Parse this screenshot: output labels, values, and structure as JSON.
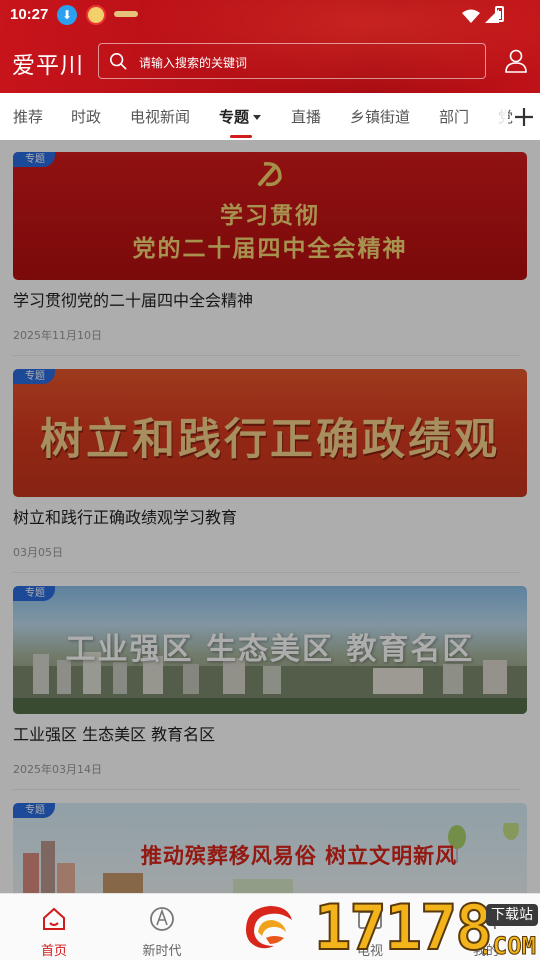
{
  "status_bar": {
    "time": "10:27"
  },
  "header": {
    "logo": "爱平川",
    "search_placeholder": "请输入搜索的关键词"
  },
  "tabs": [
    {
      "label": "推荐"
    },
    {
      "label": "时政"
    },
    {
      "label": "电视新闻"
    },
    {
      "label": "专题",
      "active": true
    },
    {
      "label": "直播"
    },
    {
      "label": "乡镇街道"
    },
    {
      "label": "部门"
    },
    {
      "label": "党"
    }
  ],
  "feed": [
    {
      "badge": "专题",
      "banner_line1": "学习贯彻",
      "banner_line2": "党的二十届四中全会精神",
      "title": "学习贯彻党的二十届四中全会精神",
      "date": "2025年11月10日"
    },
    {
      "badge": "专题",
      "banner_text": "树立和践行正确政绩观",
      "title": "树立和践行正确政绩观学习教育",
      "date": "03月05日"
    },
    {
      "badge": "专题",
      "banner_text": "工业强区 生态美区 教育名区",
      "title": "工业强区  生态美区  教育名区",
      "date": "2025年03月14日"
    },
    {
      "badge": "专题",
      "banner_text": "推动殡葬移风易俗 树立文明新风"
    }
  ],
  "bottom_nav": [
    {
      "label": "首页",
      "icon": "home-icon",
      "active": true
    },
    {
      "label": "新时代",
      "icon": "new-era-icon"
    },
    {
      "label": "",
      "icon": "app-logo-icon"
    },
    {
      "label": "电视",
      "icon": "tv-icon"
    },
    {
      "label": "我的",
      "icon": "profile-icon"
    }
  ],
  "watermark": {
    "number": "17178",
    "badge": "下载站",
    "suffix": ".COM"
  },
  "colors": {
    "brand_red": "#c8141b",
    "badge_blue": "#2a6de0",
    "active_red": "#d11a1a"
  }
}
